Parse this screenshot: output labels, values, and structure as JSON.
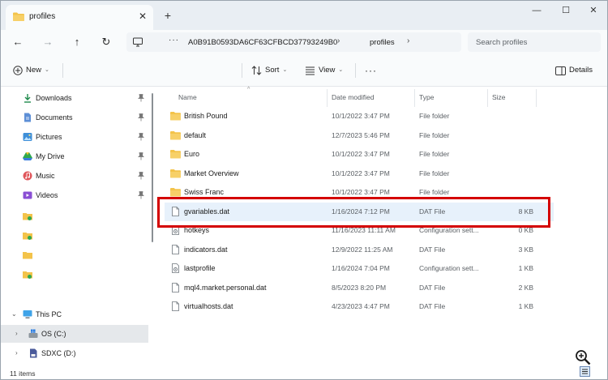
{
  "window": {
    "tab_title": "profiles",
    "new_tab_glyph": "+",
    "tab_close_glyph": "✕",
    "minimize_glyph": "—",
    "maximize_glyph": "☐",
    "close_glyph": "✕"
  },
  "nav": {
    "back_glyph": "←",
    "forward_glyph": "→",
    "up_glyph": "↑",
    "refresh_glyph": "↻"
  },
  "address": {
    "more_glyph": "···",
    "segment_1": "A0B91B0593DA6CF63CFBCD37793249B0",
    "segment_2": "profiles",
    "separator": "›"
  },
  "search": {
    "placeholder": "Search profiles"
  },
  "toolbar": {
    "new_label": "New",
    "sort_label": "Sort",
    "view_label": "View",
    "more_label": "···",
    "details_label": "Details",
    "chevron": "⌄"
  },
  "sidebar": {
    "items": [
      {
        "label": "Downloads",
        "icon": "download-icon"
      },
      {
        "label": "Documents",
        "icon": "documents-icon"
      },
      {
        "label": "Pictures",
        "icon": "pictures-icon"
      },
      {
        "label": "My Drive",
        "icon": "drive-icon"
      },
      {
        "label": "Music",
        "icon": "music-icon"
      },
      {
        "label": "Videos",
        "icon": "videos-icon"
      }
    ],
    "this_pc": "This PC",
    "os_drive": "OS (C:)",
    "sd_drive": "SDXC (D:)",
    "expand_glyph": "›",
    "expanded_glyph": "⌄"
  },
  "columns": {
    "name": "Name",
    "date": "Date modified",
    "type": "Type",
    "size": "Size",
    "sort_glyph": "^"
  },
  "files": [
    {
      "name": "British Pound",
      "date": "10/1/2022 3:47 PM",
      "type": "File folder",
      "size": "",
      "kind": "folder"
    },
    {
      "name": "default",
      "date": "12/7/2023 5:46 PM",
      "type": "File folder",
      "size": "",
      "kind": "folder"
    },
    {
      "name": "Euro",
      "date": "10/1/2022 3:47 PM",
      "type": "File folder",
      "size": "",
      "kind": "folder"
    },
    {
      "name": "Market Overview",
      "date": "10/1/2022 3:47 PM",
      "type": "File folder",
      "size": "",
      "kind": "folder"
    },
    {
      "name": "Swiss Franc",
      "date": "10/1/2022 3:47 PM",
      "type": "File folder",
      "size": "",
      "kind": "folder"
    },
    {
      "name": "gvariables.dat",
      "date": "1/16/2024 7:12 PM",
      "type": "DAT File",
      "size": "8 KB",
      "kind": "file"
    },
    {
      "name": "hotkeys",
      "date": "11/16/2023 11:11 AM",
      "type": "Configuration sett...",
      "size": "0 KB",
      "kind": "config"
    },
    {
      "name": "indicators.dat",
      "date": "12/9/2022 11:25 AM",
      "type": "DAT File",
      "size": "3 KB",
      "kind": "file"
    },
    {
      "name": "lastprofile",
      "date": "1/16/2024 7:04 PM",
      "type": "Configuration sett...",
      "size": "1 KB",
      "kind": "config"
    },
    {
      "name": "mql4.market.personal.dat",
      "date": "8/5/2023 8:20 PM",
      "type": "DAT File",
      "size": "2 KB",
      "kind": "file"
    },
    {
      "name": "virtualhosts.dat",
      "date": "4/23/2023 4:47 PM",
      "type": "DAT File",
      "size": "1 KB",
      "kind": "file"
    }
  ],
  "status": {
    "count": "11 items"
  },
  "colors": {
    "accent": "#0067c0",
    "folder": "#f3c34a",
    "highlight": "#d40000",
    "selected_row": "#e7f1fb"
  }
}
